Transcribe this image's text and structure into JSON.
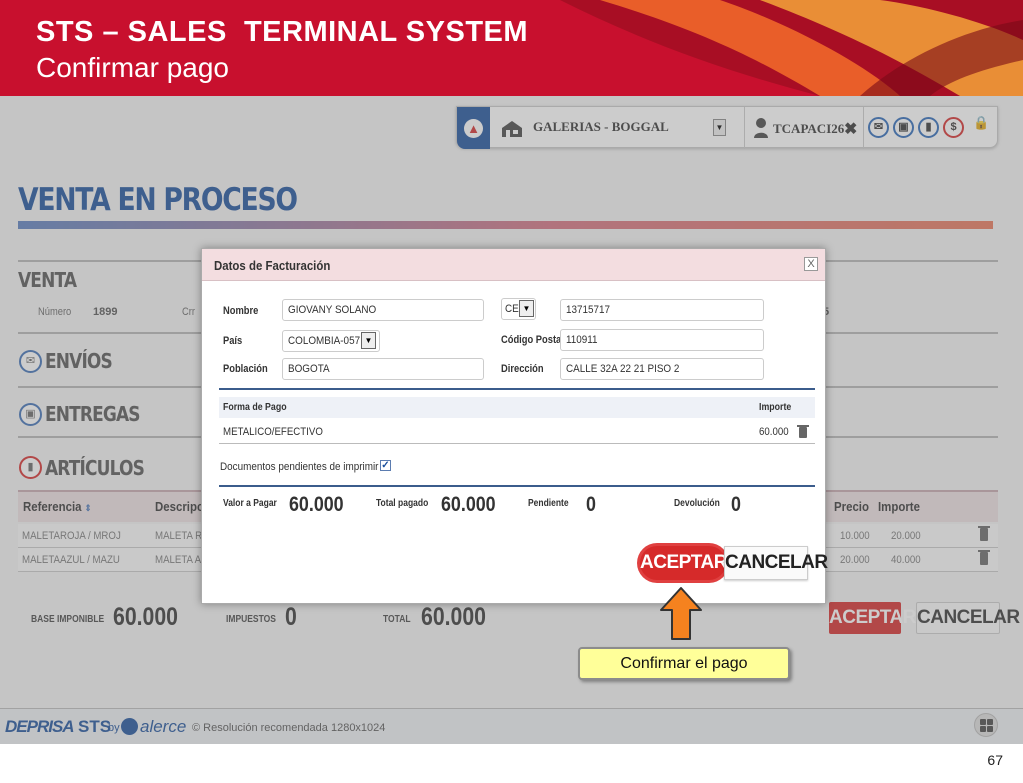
{
  "slide": {
    "title": "STS – SALES  TERMINAL SYSTEM",
    "subtitle": "Confirmar pago",
    "page_number": "67",
    "callout": "Confirmar el pago"
  },
  "topbar": {
    "store": "GALERIAS - BOGGAL",
    "user": "TCAPACI26",
    "close": "✖"
  },
  "page": {
    "title": "VENTA EN PROCESO"
  },
  "venta": {
    "title": "VENTA",
    "numero_label": "Número",
    "numero": "1899",
    "crr_label": "Crr",
    "right_digit": "5"
  },
  "sections": {
    "envios": "ENVÍOS",
    "entregas": "ENTREGAS",
    "articulos": "ARTÍCULOS"
  },
  "articles": {
    "headers": {
      "referencia": "Referencia",
      "descripcion": "Descripc",
      "precio": "Precio",
      "importe": "Importe"
    },
    "rows": [
      {
        "ref": "MALETAROJA / MROJ",
        "desc": "MALETA RO",
        "precio": "10.000",
        "importe": "20.000"
      },
      {
        "ref": "MALETAAZUL / MAZU",
        "desc": "MALETA AZ",
        "precio": "20.000",
        "importe": "40.000"
      }
    ]
  },
  "totals": {
    "base_label": "BASE IMPONIBLE",
    "base": "60.000",
    "impuestos_label": "IMPUESTOS",
    "impuestos": "0",
    "total_label": "TOTAL",
    "total": "60.000"
  },
  "buttons": {
    "aceptar": "ACEPTAR",
    "cancelar": "CANCELAR"
  },
  "modal": {
    "title": "Datos de Facturación",
    "close": "X",
    "nombre_label": "Nombre",
    "nombre": "GIOVANY SOLANO",
    "doc_type": "CE",
    "doc_number": "13715717",
    "pais_label": "País",
    "pais": "COLOMBIA-057",
    "cp_label": "Código Postal",
    "cp": "110911",
    "poblacion_label": "Población",
    "poblacion": "BOGOTA",
    "direccion_label": "Dirección",
    "direccion": "CALLE 32A 22 21 PISO 2",
    "forma_pago_label": "Forma de Pago",
    "importe_label": "Importe",
    "forma_pago": "METALICO/EFECTIVO",
    "forma_importe": "60.000",
    "docs_pendientes": "Documentos pendientes de imprimir",
    "checkmark": "✓",
    "valor_label": "Valor a Pagar",
    "valor": "60.000",
    "total_pagado_label": "Total pagado",
    "total_pagado": "60.000",
    "pendiente_label": "Pendiente",
    "pendiente": "0",
    "devolucion_label": "Devolución",
    "devolucion": "0",
    "aceptar": "ACEPTAR",
    "cancelar": "CANCELAR"
  },
  "footer": {
    "brand": "DEPRISA",
    "sts": "STS",
    "by": "by",
    "alerce": "alerce",
    "copyright": "© Resolución recomendada 1280x1024"
  },
  "colors": {
    "brand_red": "#c8102e",
    "brand_blue": "#1b4f9c",
    "accept_red": "#d62a2a",
    "arrow_orange": "#f5821f",
    "callout_yellow": "#ffff99"
  }
}
